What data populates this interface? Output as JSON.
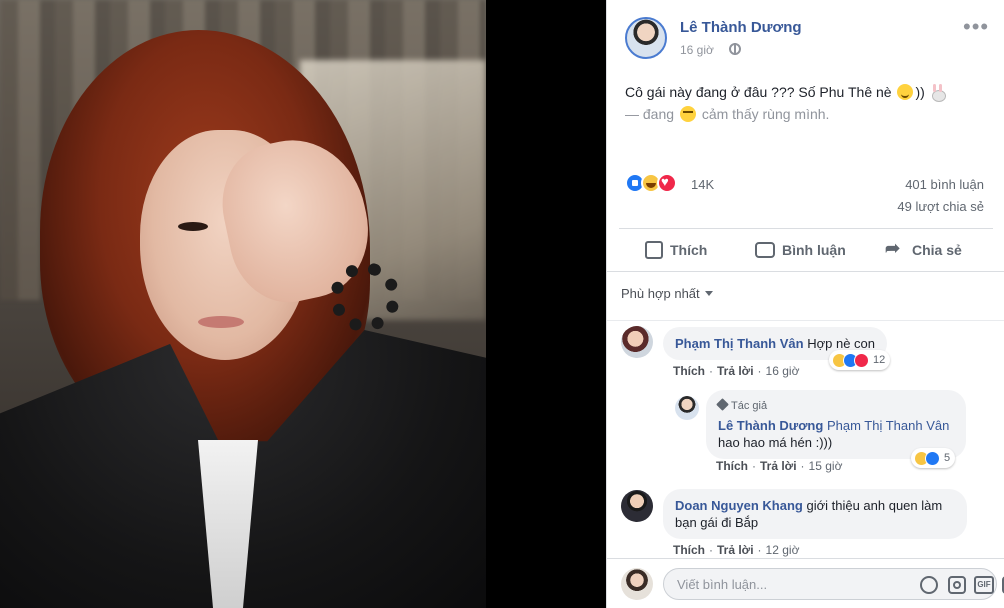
{
  "post": {
    "author": "Lê Thành Dương",
    "time": "16 giờ",
    "text_main": "Cô gái này đang ở đâu ??? Số Phu Thê nè",
    "text_tail": "))",
    "feeling_prefix": "— đang",
    "feeling": "cảm thấy rùng mình.",
    "reactions_total": "14K",
    "comment_count": "401 bình luận",
    "share_count": "49 lượt chia sẻ"
  },
  "actions": {
    "like": "Thích",
    "comment": "Bình luận",
    "share": "Chia sẻ"
  },
  "sort_label": "Phù hợp nhất",
  "comments": [
    {
      "name": "Phạm Thị Thanh Vân",
      "text": "Hợp nè con",
      "like_label": "Thích",
      "reply_label": "Trả lời",
      "time": "16 giờ",
      "reaction_count": "12"
    },
    {
      "author_tag": "Tác giả",
      "name": "Lê Thành Dương",
      "mention": "Phạm Thị Thanh Vân",
      "text": "hao hao má hén :)))",
      "like_label": "Thích",
      "reply_label": "Trả lời",
      "time": "15 giờ",
      "reaction_count": "5"
    },
    {
      "name": "Doan Nguyen Khang",
      "text": "giới thiệu anh quen làm bạn gái đi Bắp",
      "like_label": "Thích",
      "reply_label": "Trả lời",
      "time": "12 giờ"
    }
  ],
  "composer": {
    "placeholder": "Viết bình luận...",
    "gif_label": "GIF"
  },
  "colors": {
    "link": "#385898",
    "like_blue": "#2078f4",
    "love_red": "#f0284a",
    "haha_yellow": "#f7c543"
  }
}
